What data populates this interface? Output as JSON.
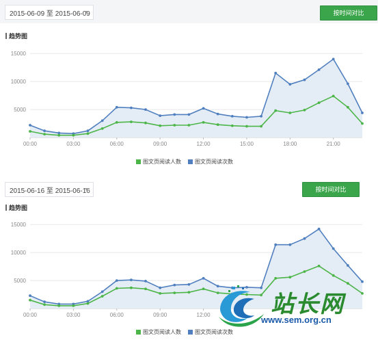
{
  "colors": {
    "reads": "#4cb548",
    "count": "#4f7fbf",
    "area": "#e4edf5",
    "button": "#3aa54a",
    "grid": "#e8e8e8"
  },
  "panels": [
    {
      "date_range": "2015-06-09 至 2015-06-09",
      "compare_label": "按时间对比",
      "section_title": "趋势图"
    },
    {
      "date_range": "2015-06-16 至 2015-06-16",
      "compare_label": "按时间对比",
      "section_title": "趋势图"
    }
  ],
  "legend": {
    "reads_label": "图文页阅读人数",
    "count_label": "图文页阅读次数"
  },
  "watermark": {
    "logo": "站长网",
    "url": "www.sem.org.cn"
  },
  "chart_data": [
    {
      "type": "area",
      "x": [
        0,
        1,
        2,
        3,
        4,
        5,
        6,
        7,
        8,
        9,
        10,
        11,
        12,
        13,
        14,
        15,
        16,
        17,
        18,
        19,
        20,
        21,
        22,
        23
      ],
      "xticks": [
        "00:00",
        "03:00",
        "06:00",
        "09:00",
        "12:00",
        "15:00",
        "18:00",
        "21:00"
      ],
      "xtick_positions": [
        0,
        3,
        6,
        9,
        12,
        15,
        18,
        21
      ],
      "yticks": [
        "5000",
        "10000",
        "15000"
      ],
      "ytick_values": [
        5000,
        10000,
        15000
      ],
      "ylim": [
        0,
        16000
      ],
      "series": [
        {
          "name": "图文页阅读次数",
          "values": [
            2200,
            1200,
            800,
            700,
            1200,
            3000,
            5400,
            5300,
            5000,
            3900,
            4100,
            4100,
            5200,
            4200,
            3800,
            3600,
            3800,
            11500,
            9500,
            10300,
            12100,
            14000,
            9600,
            4400
          ]
        },
        {
          "name": "图文页阅读人数",
          "values": [
            1100,
            600,
            400,
            400,
            700,
            1600,
            2700,
            2800,
            2600,
            2100,
            2200,
            2200,
            2700,
            2300,
            2100,
            2000,
            2000,
            4800,
            4400,
            4900,
            6200,
            7400,
            5400,
            2500
          ]
        }
      ]
    },
    {
      "type": "area",
      "x": [
        0,
        1,
        2,
        3,
        4,
        5,
        6,
        7,
        8,
        9,
        10,
        11,
        12,
        13,
        14,
        15,
        16,
        17,
        18,
        19,
        20,
        21,
        22,
        23
      ],
      "xticks": [
        "00:00",
        "03:00",
        "06:00",
        "09:00",
        "12:00"
      ],
      "xtick_positions": [
        0,
        3,
        6,
        9,
        12
      ],
      "yticks": [
        "5000",
        "10000",
        "15000"
      ],
      "ytick_values": [
        5000,
        10000,
        15000
      ],
      "ylim": [
        0,
        16000
      ],
      "series": [
        {
          "name": "图文页阅读次数",
          "values": [
            2300,
            1200,
            800,
            800,
            1300,
            3000,
            5000,
            5100,
            4900,
            3700,
            4200,
            4300,
            5400,
            4000,
            3700,
            3800,
            3700,
            11400,
            11400,
            12500,
            14200,
            10700,
            7700,
            4800
          ]
        },
        {
          "name": "图文页阅读人数",
          "values": [
            1500,
            700,
            500,
            500,
            900,
            2200,
            3600,
            3700,
            3500,
            2700,
            2800,
            2900,
            3500,
            2800,
            2600,
            2500,
            2400,
            5400,
            5600,
            6600,
            7600,
            5900,
            4500,
            2700
          ]
        }
      ]
    }
  ]
}
